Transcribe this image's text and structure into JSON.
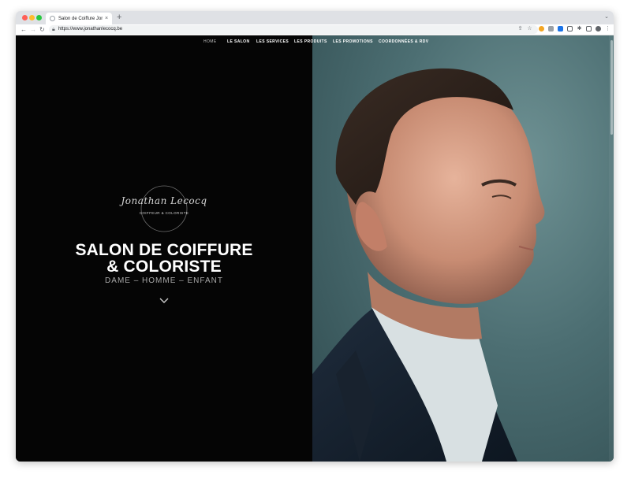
{
  "browser": {
    "tab_title": "Salon de Coiffure Jonathan Le",
    "tab_close": "×",
    "new_tab": "+",
    "url": "https://www.jonathanlecocq.be"
  },
  "nav": {
    "items": [
      {
        "label": "HOME",
        "active": true
      },
      {
        "label": "LE SALON"
      },
      {
        "label": "LES SERVICES"
      },
      {
        "label": "LES PRODUITS"
      },
      {
        "label": "LES PROMOTIONS"
      },
      {
        "label": "COORDONNÉES & RDV"
      }
    ]
  },
  "hero": {
    "logo_script": "Jonathan Lecocq",
    "logo_tagline": "COIFFEUR & COLORISTE",
    "title_line1": "SALON DE COIFFURE",
    "title_line2": "& COLORISTE",
    "subtitle": "DAME – HOMME – ENFANT"
  },
  "icons": {
    "scroll": "chevron-down-icon",
    "photo": "man-profile-portrait"
  },
  "colors": {
    "left_bg": "#050505",
    "photo_bg": "#4c6e72",
    "title": "#ffffff",
    "subtitle": "#a7a7a7"
  }
}
